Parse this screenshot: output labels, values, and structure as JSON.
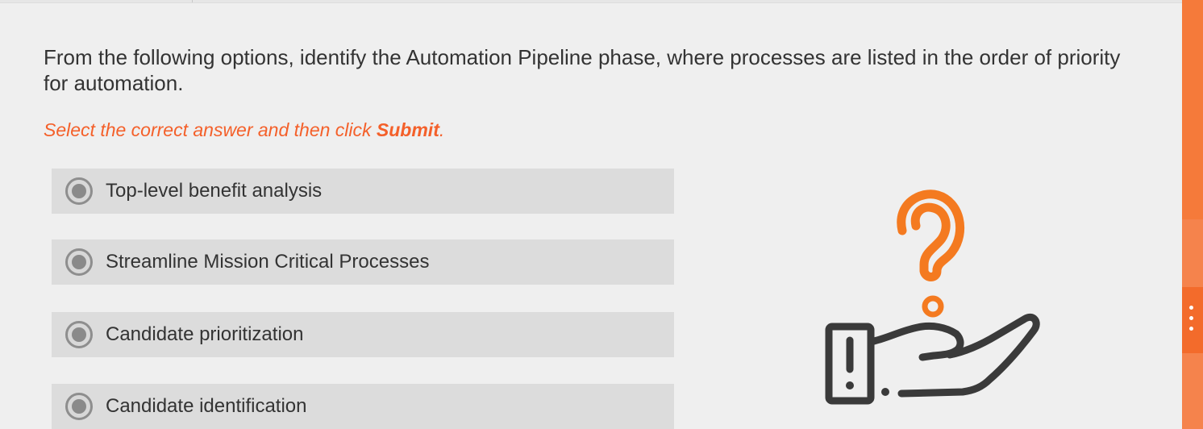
{
  "question": {
    "text": "From the following options, identify the Automation Pipeline phase, where processes are listed in the order of priority for automation."
  },
  "instruction": {
    "prefix": "Select the correct answer and then click ",
    "action": "Submit",
    "suffix": "."
  },
  "options": [
    {
      "label": "Top-level benefit analysis"
    },
    {
      "label": "Streamline Mission Critical Processes"
    },
    {
      "label": "Candidate prioritization"
    },
    {
      "label": "Candidate identification"
    }
  ],
  "illustration": {
    "icon": "question-hand-icon",
    "accent_color": "#f47a20",
    "line_color": "#3a3a3a"
  },
  "colors": {
    "accent": "#f4602a",
    "rail": "#f47a3a",
    "option_bg": "#dcdcdc",
    "page_bg": "#efefef"
  },
  "side_menu": {
    "icon": "more-vertical-icon"
  }
}
